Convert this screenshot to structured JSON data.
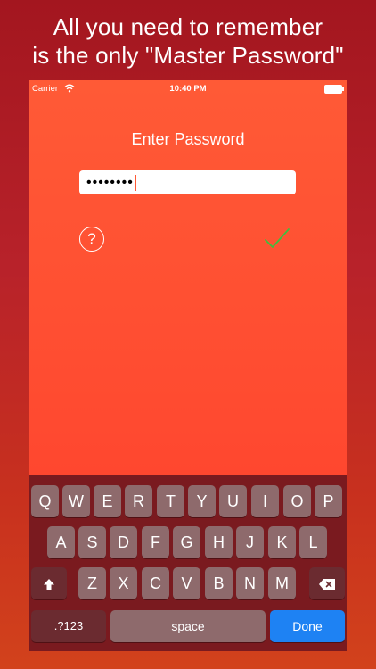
{
  "headline": {
    "line1": "All you need to remember",
    "line2": "is the only \"Master Password\""
  },
  "status_bar": {
    "carrier": "Carrier",
    "time": "10:40 PM",
    "wifi_icon": "wifi-icon",
    "battery_icon": "battery-icon"
  },
  "screen": {
    "title": "Enter Password",
    "password_value": "••••••••",
    "help_label": "?",
    "confirm_icon": "checkmark-icon"
  },
  "keyboard": {
    "row1": [
      "Q",
      "W",
      "E",
      "R",
      "T",
      "Y",
      "U",
      "I",
      "O",
      "P"
    ],
    "row2": [
      "A",
      "S",
      "D",
      "F",
      "G",
      "H",
      "J",
      "K",
      "L"
    ],
    "row3": [
      "Z",
      "X",
      "C",
      "V",
      "B",
      "N",
      "M"
    ],
    "shift_icon": "shift-arrow-icon",
    "delete_icon": "backspace-icon",
    "numbers_label": ".?123",
    "space_label": "space",
    "done_label": "Done"
  },
  "colors": {
    "background": "#b8222a",
    "screen": "#ff4a30",
    "keyboard": "#7a1a1f",
    "key": "#8e6a6c",
    "done": "#1e82f3",
    "checkmark": "#3fbf3f"
  }
}
